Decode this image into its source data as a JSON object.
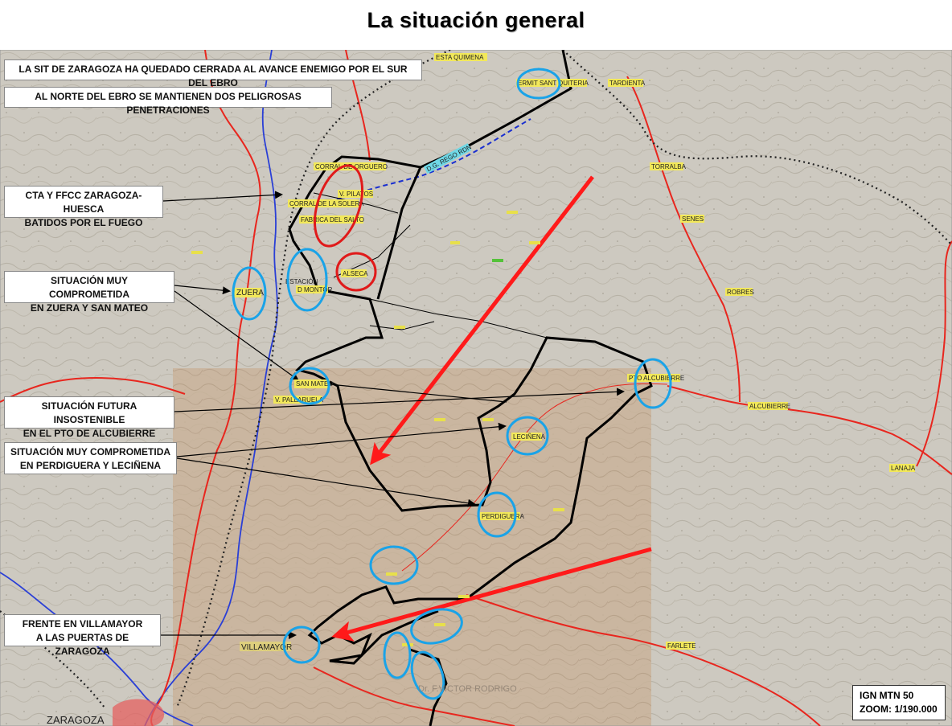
{
  "title": "La situación general",
  "notes": [
    {
      "id": "n1",
      "text": "LA SIT DE ZARAGOZA HA QUEDADO CERRADA AL AVANCE ENEMIGO POR EL SUR DEL EBRO"
    },
    {
      "id": "n2",
      "text": "AL NORTE DEL EBRO SE MANTIENEN DOS PELIGROSAS PENETRACIONES"
    },
    {
      "id": "n3",
      "line1": "CTA Y FFCC ZARAGOZA-HUESCA",
      "line2": "BATIDOS POR EL FUEGO"
    },
    {
      "id": "n4",
      "line1": "SITUACIÓN MUY COMPROMETIDA",
      "line2": "EN ZUERA Y SAN MATEO"
    },
    {
      "id": "n5",
      "line1": "SITUACIÓN FUTURA INSOSTENIBLE",
      "line2": "EN EL PTO DE ALCUBIERRE"
    },
    {
      "id": "n6",
      "line1": "SITUACIÓN MUY COMPROMETIDA",
      "line2": "EN PERDIGUERA Y LECIÑENA"
    },
    {
      "id": "n7",
      "line1": "FRENTE EN VILLAMAYOR",
      "line2": "A LAS PUERTAS DE ZARAGOZA"
    }
  ],
  "places": {
    "zuera": "ZUERA",
    "estacion": "ESTACIÓN",
    "montoro": "D MONTOR",
    "sanmateo": "SAN MATEO",
    "pallaruelo": "V. PALLARUELA",
    "leciñena": "LECIÑENA",
    "perdiguera": "PERDIGUERA",
    "villamayor": "VILLAMAYOR",
    "zaragoza": "ZARAGOZA",
    "alcubierre": "ALCUBIERRE",
    "ptoalcubierre": "PTO ALCUBIERRE",
    "torralba": "TORRALBA",
    "senes": "SENES",
    "robres": "ROBRES",
    "lanaja": "LANAJA",
    "farlete": "FARLETE",
    "tardienta": "TARDIENTA",
    "ermita": "ERMIT SANTA",
    "quiteria": "QUITERIA",
    "esquinas": "ESTA QUIMENA",
    "corral": "CORRAL DE ORGUERO",
    "corral2": "CORRAL DE LA SOLERA",
    "fabrica": "FABRICA DEL SALTO",
    "pilatos": "V. PILATOS",
    "alseca": "ALSECA",
    "riogallego": "D.G. REGO RDN"
  },
  "watermark": "Dr. F.VICTOR RODRIGO",
  "scale": {
    "line1": "IGN MTN 50",
    "line2": "ZOOM: 1/190.000"
  },
  "colors": {
    "front": "#000000",
    "attack_arrow": "#ff1a1a",
    "roads": "#e8261e",
    "river": "#2a3fd6",
    "circle_blue": "#1aa3e8",
    "circle_red": "#e01a1a"
  }
}
